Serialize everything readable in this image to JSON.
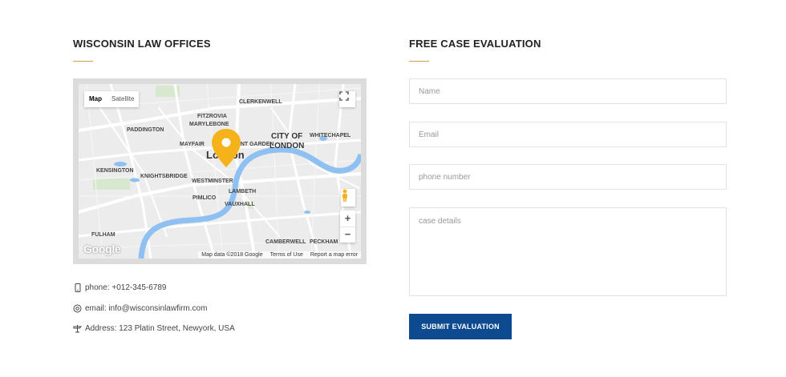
{
  "offices": {
    "title": "WISCONSIN LAW OFFICES",
    "accent_color": "#c9a14a"
  },
  "map": {
    "type_buttons": [
      "Map",
      "Satellite"
    ],
    "active_type": "Map",
    "labels": {
      "clerkenwell": "CLERKENWELL",
      "fitzrovia": "FITZROVIA",
      "marylebone": "MARYLEBONE",
      "paddington": "PADDINGTON",
      "mayfair": "MAYFAIR",
      "covent_garden": "COVENT GARDEN",
      "city1": "CITY OF",
      "city2": "LONDON",
      "whitechapel": "WHITECHAPEL",
      "london": "London",
      "kensington": "KENSINGTON",
      "knightsbridge": "KNIGHTSBRIDGE",
      "westminster": "WESTMINSTER",
      "lambeth": "LAMBETH",
      "pimlico": "PIMLICO",
      "vauxhall": "VAUXHALL",
      "fulham": "FULHAM",
      "camberwell": "CAMBERWELL",
      "peckham": "PECKHAM"
    },
    "zoom_in": "+",
    "zoom_out": "−",
    "attribution": [
      "Map data ©2018 Google",
      "Terms of Use",
      "Report a map error"
    ],
    "watermark": "Google",
    "pin_color": "#f6b21a",
    "river_color": "#8fc0f2"
  },
  "contact": {
    "phone": "phone: +012-345-6789",
    "email": "email: info@wisconsinlawfirm.com",
    "address": "Address: 123 Platin Street, Newyork, USA"
  },
  "form": {
    "title": "FREE CASE EVALUATION",
    "name_placeholder": "Name",
    "email_placeholder": "Email",
    "phone_placeholder": "phone number",
    "details_placeholder": "case details",
    "submit_label": "SUBMIT EVALUATION",
    "submit_color": "#0d4a8f"
  }
}
